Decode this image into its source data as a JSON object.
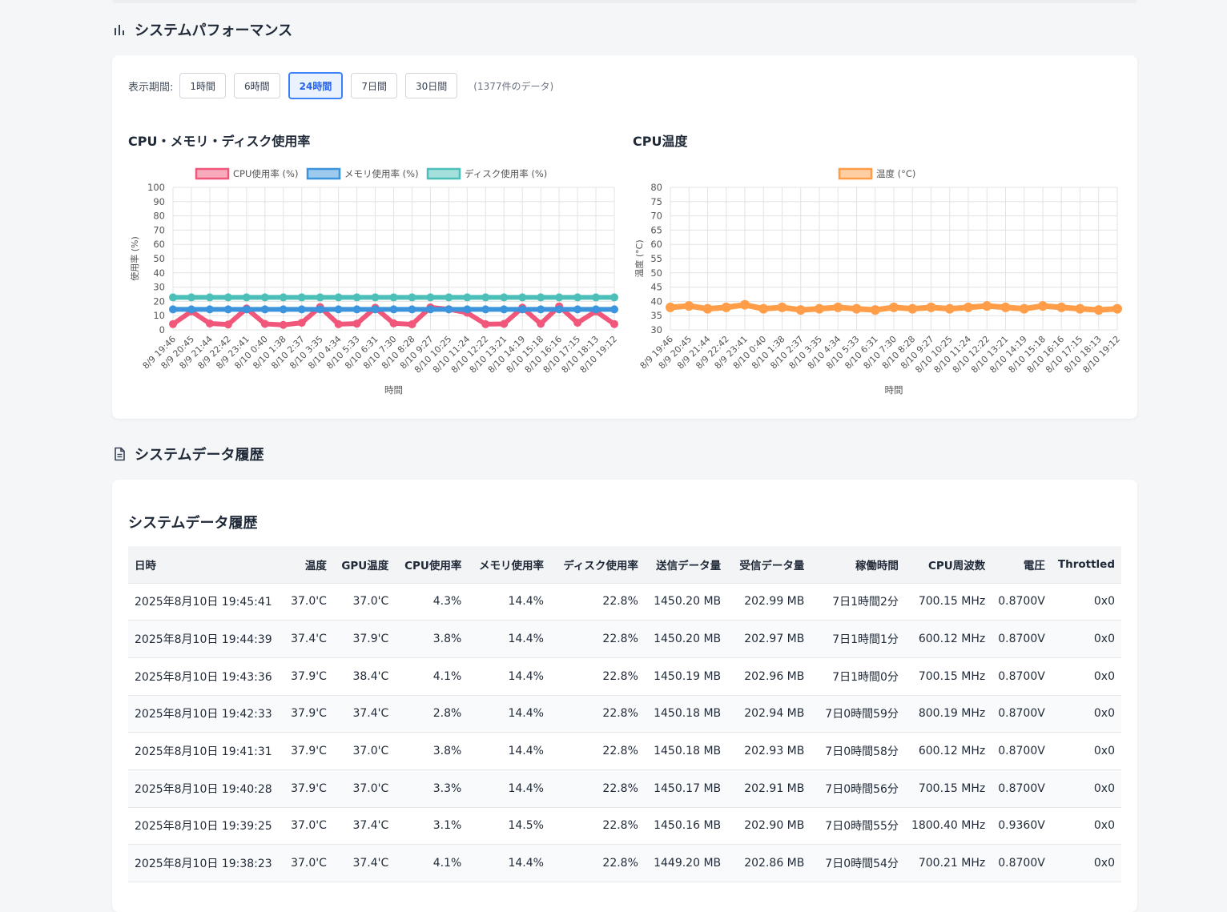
{
  "perf_section": {
    "title": "システムパフォーマンス",
    "icon": "bar-chart-icon"
  },
  "period": {
    "label": "表示期間:",
    "buttons": [
      "1時間",
      "6時間",
      "24時間",
      "7日間",
      "30日間"
    ],
    "active": "24時間",
    "count": "(1377件のデータ)"
  },
  "colors": {
    "cpu": "#f0577a",
    "memory": "#3b94dc",
    "disk": "#4bbfb8",
    "temp": "#ff9d48",
    "accent": "#3b82f6"
  },
  "charts": [
    {
      "chart_data": {
        "type": "line",
        "title": "CPU・メモリ・ディスク使用率",
        "xlabel": "時間",
        "ylabel": "使用率 (%)",
        "ylim": [
          0,
          100
        ],
        "yticks": [
          0,
          10,
          20,
          30,
          40,
          50,
          60,
          70,
          80,
          90,
          100
        ],
        "categories": [
          "8/9 19:46",
          "8/9 20:45",
          "8/9 21:44",
          "8/9 22:42",
          "8/9 23:41",
          "8/10 0:40",
          "8/10 1:38",
          "8/10 2:37",
          "8/10 3:35",
          "8/10 4:34",
          "8/10 5:33",
          "8/10 6:31",
          "8/10 7:30",
          "8/10 8:28",
          "8/10 9:27",
          "8/10 10:25",
          "8/10 11:24",
          "8/10 12:22",
          "8/10 13:21",
          "8/10 14:19",
          "8/10 15:18",
          "8/10 16:16",
          "8/10 17:15",
          "8/10 18:13",
          "8/10 19:12"
        ],
        "legend_position": "top",
        "grid": true,
        "series": [
          {
            "name": "CPU使用率 (%)",
            "values": [
              4.1,
              13.0,
              4.5,
              3.8,
              15.0,
              4.2,
              3.5,
              5.0,
              16.0,
              4.0,
              4.4,
              15.5,
              4.6,
              3.9,
              15.8,
              14.5,
              12.0,
              4.0,
              4.2,
              15.6,
              4.3,
              16.5,
              5.0,
              13.0,
              4.1
            ]
          },
          {
            "name": "メモリ使用率 (%)",
            "values": [
              14.4,
              14.4,
              14.4,
              14.4,
              14.4,
              14.4,
              14.4,
              14.4,
              14.4,
              14.4,
              14.4,
              14.4,
              14.4,
              14.4,
              14.4,
              14.4,
              14.4,
              14.4,
              14.4,
              14.4,
              14.4,
              14.4,
              14.4,
              14.4,
              14.4
            ]
          },
          {
            "name": "ディスク使用率 (%)",
            "values": [
              22.8,
              22.8,
              22.8,
              22.8,
              22.8,
              22.8,
              22.8,
              22.8,
              22.8,
              22.8,
              22.8,
              22.8,
              22.8,
              22.8,
              22.8,
              22.8,
              22.8,
              22.8,
              22.8,
              22.8,
              22.8,
              22.8,
              22.8,
              22.8,
              22.8
            ]
          }
        ]
      }
    },
    {
      "chart_data": {
        "type": "line",
        "title": "CPU温度",
        "xlabel": "時間",
        "ylabel": "温度 (°C)",
        "ylim": [
          30,
          80
        ],
        "yticks": [
          30,
          35,
          40,
          45,
          50,
          55,
          60,
          65,
          70,
          75,
          80
        ],
        "categories": [
          "8/9 19:46",
          "8/9 20:45",
          "8/9 21:44",
          "8/9 22:42",
          "8/9 23:41",
          "8/10 0:40",
          "8/10 1:38",
          "8/10 2:37",
          "8/10 3:35",
          "8/10 4:34",
          "8/10 5:33",
          "8/10 6:31",
          "8/10 7:30",
          "8/10 8:28",
          "8/10 9:27",
          "8/10 10:25",
          "8/10 11:24",
          "8/10 12:22",
          "8/10 13:21",
          "8/10 14:19",
          "8/10 15:18",
          "8/10 16:16",
          "8/10 17:15",
          "8/10 18:13",
          "8/10 19:12"
        ],
        "legend_position": "top",
        "grid": true,
        "series": [
          {
            "name": "温度 (°C)",
            "values": [
              37.9,
              38.4,
              37.4,
              37.9,
              38.8,
              37.4,
              37.9,
              37.0,
              37.4,
              37.9,
              37.4,
              37.0,
              37.9,
              37.4,
              37.9,
              37.4,
              37.9,
              38.4,
              37.9,
              37.4,
              38.4,
              37.9,
              37.4,
              37.0,
              37.4
            ]
          }
        ]
      }
    }
  ],
  "history_section": {
    "title": "システムデータ履歴",
    "icon": "document-icon"
  },
  "history": {
    "title": "システムデータ履歴",
    "columns": [
      "日時",
      "温度",
      "GPU温度",
      "CPU使用率",
      "メモリ使用率",
      "ディスク使用率",
      "送信データ量",
      "受信データ量",
      "稼働時間",
      "CPU周波数",
      "電圧",
      "Throttled"
    ],
    "rows": [
      [
        "2025年8月10日 19:45:41",
        "37.0'C",
        "37.0'C",
        "4.3%",
        "14.4%",
        "22.8%",
        "1450.20 MB",
        "202.99 MB",
        "7日1時間2分",
        "700.15 MHz",
        "0.8700V",
        "0x0"
      ],
      [
        "2025年8月10日 19:44:39",
        "37.4'C",
        "37.9'C",
        "3.8%",
        "14.4%",
        "22.8%",
        "1450.20 MB",
        "202.97 MB",
        "7日1時間1分",
        "600.12 MHz",
        "0.8700V",
        "0x0"
      ],
      [
        "2025年8月10日 19:43:36",
        "37.9'C",
        "38.4'C",
        "4.1%",
        "14.4%",
        "22.8%",
        "1450.19 MB",
        "202.96 MB",
        "7日1時間0分",
        "700.15 MHz",
        "0.8700V",
        "0x0"
      ],
      [
        "2025年8月10日 19:42:33",
        "37.9'C",
        "37.4'C",
        "2.8%",
        "14.4%",
        "22.8%",
        "1450.18 MB",
        "202.94 MB",
        "7日0時間59分",
        "800.19 MHz",
        "0.8700V",
        "0x0"
      ],
      [
        "2025年8月10日 19:41:31",
        "37.9'C",
        "37.0'C",
        "3.8%",
        "14.4%",
        "22.8%",
        "1450.18 MB",
        "202.93 MB",
        "7日0時間58分",
        "600.12 MHz",
        "0.8700V",
        "0x0"
      ],
      [
        "2025年8月10日 19:40:28",
        "37.9'C",
        "37.0'C",
        "3.3%",
        "14.4%",
        "22.8%",
        "1450.17 MB",
        "202.91 MB",
        "7日0時間56分",
        "700.15 MHz",
        "0.8700V",
        "0x0"
      ],
      [
        "2025年8月10日 19:39:25",
        "37.0'C",
        "37.4'C",
        "3.1%",
        "14.5%",
        "22.8%",
        "1450.16 MB",
        "202.90 MB",
        "7日0時間55分",
        "1800.40 MHz",
        "0.9360V",
        "0x0"
      ],
      [
        "2025年8月10日 19:38:23",
        "37.0'C",
        "37.4'C",
        "4.1%",
        "14.4%",
        "22.8%",
        "1449.20 MB",
        "202.86 MB",
        "7日0時間54分",
        "700.21 MHz",
        "0.8700V",
        "0x0"
      ]
    ]
  }
}
